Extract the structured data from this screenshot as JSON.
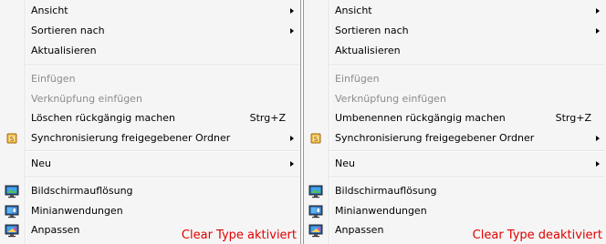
{
  "left_menu": {
    "items": [
      {
        "label": "Ansicht"
      },
      {
        "label": "Sortieren nach"
      },
      {
        "label": "Aktualisieren"
      },
      {
        "label": "Einfügen"
      },
      {
        "label": "Verknüpfung einfügen"
      },
      {
        "label": "Löschen rückgängig machen",
        "shortcut": "Strg+Z"
      },
      {
        "label": "Synchronisierung freigegebener Ordner"
      },
      {
        "label": "Neu"
      },
      {
        "label": "Bildschirmauflösung"
      },
      {
        "label": "Minianwendungen"
      },
      {
        "label": "Anpassen"
      }
    ],
    "caption": "Clear Type aktiviert"
  },
  "right_menu": {
    "items": [
      {
        "label": "Ansicht"
      },
      {
        "label": "Sortieren nach"
      },
      {
        "label": "Aktualisieren"
      },
      {
        "label": "Einfügen"
      },
      {
        "label": "Verknüpfung einfügen"
      },
      {
        "label": "Umbenennen rückgängig machen",
        "shortcut": "Strg+Z"
      },
      {
        "label": "Synchronisierung freigegebener Ordner"
      },
      {
        "label": "Neu"
      },
      {
        "label": "Bildschirmauflösung"
      },
      {
        "label": "Minianwendungen"
      },
      {
        "label": "Anpassen"
      }
    ],
    "caption": "Clear Type deaktiviert"
  },
  "colors": {
    "menu_background": "#f5f5f5",
    "disabled_text": "#8c8c8c",
    "caption_text": "#e00000"
  },
  "icons": [
    "sync-folder-icon",
    "screen-resolution-icon",
    "gadgets-icon",
    "personalize-icon"
  ]
}
